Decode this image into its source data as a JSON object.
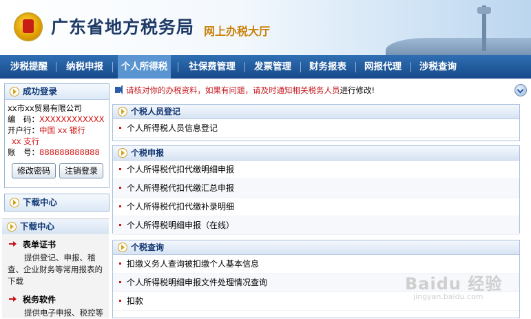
{
  "header": {
    "title": "广东省地方税务局",
    "subtitle": "网上办税大厅"
  },
  "nav": {
    "items": [
      {
        "label": "涉税提醒"
      },
      {
        "label": "纳税申报"
      },
      {
        "label": "个人所得税"
      },
      {
        "label": "社保费管理"
      },
      {
        "label": "发票管理"
      },
      {
        "label": "财务报表"
      },
      {
        "label": "网报代理"
      },
      {
        "label": "涉税查询"
      }
    ],
    "active_index": 2
  },
  "login": {
    "heading": "成功登录",
    "company": "xx市xx贸易有限公司",
    "code_label": "编　码：",
    "code_value": "XXXXXXXXXXXX",
    "bank_label": "开户行：",
    "bank_value_1": "中国 xx 银行",
    "bank_value_2": "xx 支行",
    "account_label": "账　号：",
    "account_value": "888888888888",
    "change_password": "修改密码",
    "logout": "注销登录"
  },
  "download_center": {
    "heading": "下载中心"
  },
  "download_panel": {
    "heading": "下载中心",
    "items": [
      {
        "title": "表单证书",
        "desc": "提供登记、申报、稽查、企业财务等常用报表的下载"
      },
      {
        "title": "税务软件",
        "desc": "提供电子申报、税控等"
      }
    ]
  },
  "notice": {
    "text": "请核对你的办税资料，如果有问题，请及时通知相关税务人员",
    "text_tail": "进行修改!"
  },
  "sections": [
    {
      "title": "个税人员登记",
      "items": [
        "个人所得税人员信息登记"
      ]
    },
    {
      "title": "个税申报",
      "items": [
        "个人所得税代扣代缴明细申报",
        "个人所得税代扣代缴汇总申报",
        "个人所得税代扣代缴补录明细",
        "个人所得税明细申报（在线）"
      ]
    },
    {
      "title": "个税查询",
      "items": [
        "扣缴义务人查询被扣缴个人基本信息",
        "个人所得税明细申报文件处理情况查询",
        "扣款"
      ]
    }
  ],
  "watermark": {
    "brand": "Baidu 经验",
    "url": "jingyan.baidu.com"
  },
  "colors": {
    "nav_bg": "#1f5a9e",
    "nav_active": "#5a95d2",
    "title_blue": "#1e3a66",
    "accent_red": "#c4161c",
    "subtitle_gold": "#c9820a"
  }
}
